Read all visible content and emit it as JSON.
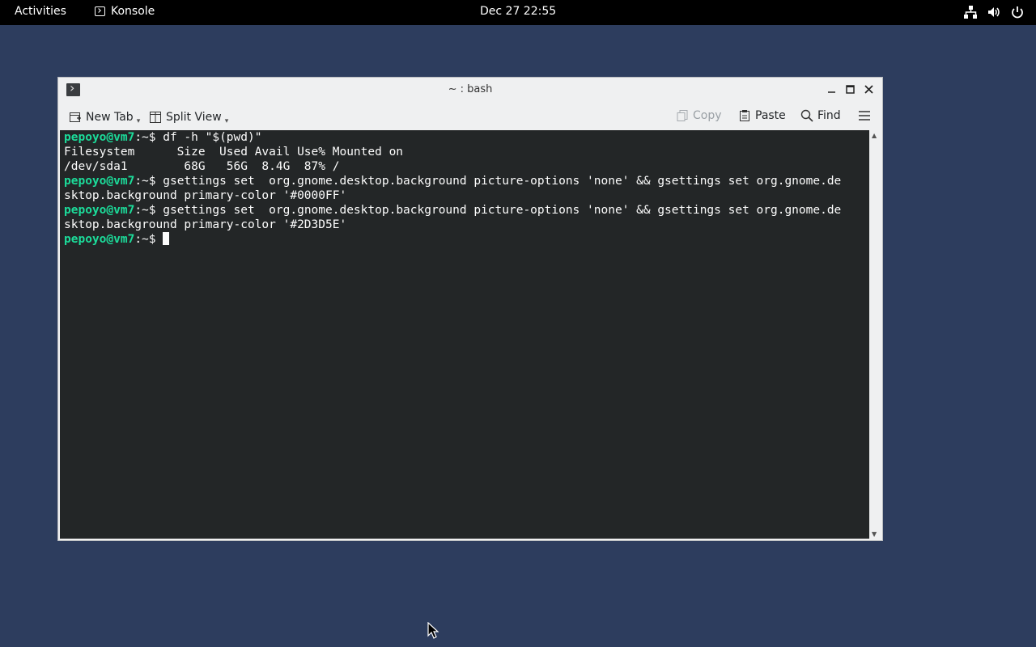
{
  "topbar": {
    "activities": "Activities",
    "app_name": "Konsole",
    "clock": "Dec 27  22:55",
    "icons": [
      "network-icon",
      "volume-icon",
      "power-icon"
    ]
  },
  "window": {
    "title": "~ : bash",
    "toolbar": {
      "new_tab": "New Tab",
      "split_view": "Split View",
      "copy": "Copy",
      "paste": "Paste",
      "find": "Find"
    }
  },
  "terminal": {
    "prompt_user": "pepoyo@vm7",
    "prompt_path": ":~$ ",
    "lines": [
      {
        "type": "prompt",
        "text": "df -h \"$(pwd)\""
      },
      {
        "type": "output",
        "text": "Filesystem      Size  Used Avail Use% Mounted on"
      },
      {
        "type": "output",
        "text": "/dev/sda1        68G   56G  8.4G  87% /"
      },
      {
        "type": "prompt",
        "text": "gsettings set  org.gnome.desktop.background picture-options 'none' && gsettings set org.gnome.de"
      },
      {
        "type": "output",
        "text": "sktop.background primary-color '#0000FF'"
      },
      {
        "type": "prompt",
        "text": "gsettings set  org.gnome.desktop.background picture-options 'none' && gsettings set org.gnome.de"
      },
      {
        "type": "output",
        "text": "sktop.background primary-color '#2D3D5E'"
      },
      {
        "type": "prompt",
        "text": ""
      }
    ]
  },
  "colors": {
    "desktop_background": "#2D3D5E",
    "prompt_user": "#1cdc9a",
    "terminal_background": "#232627"
  }
}
